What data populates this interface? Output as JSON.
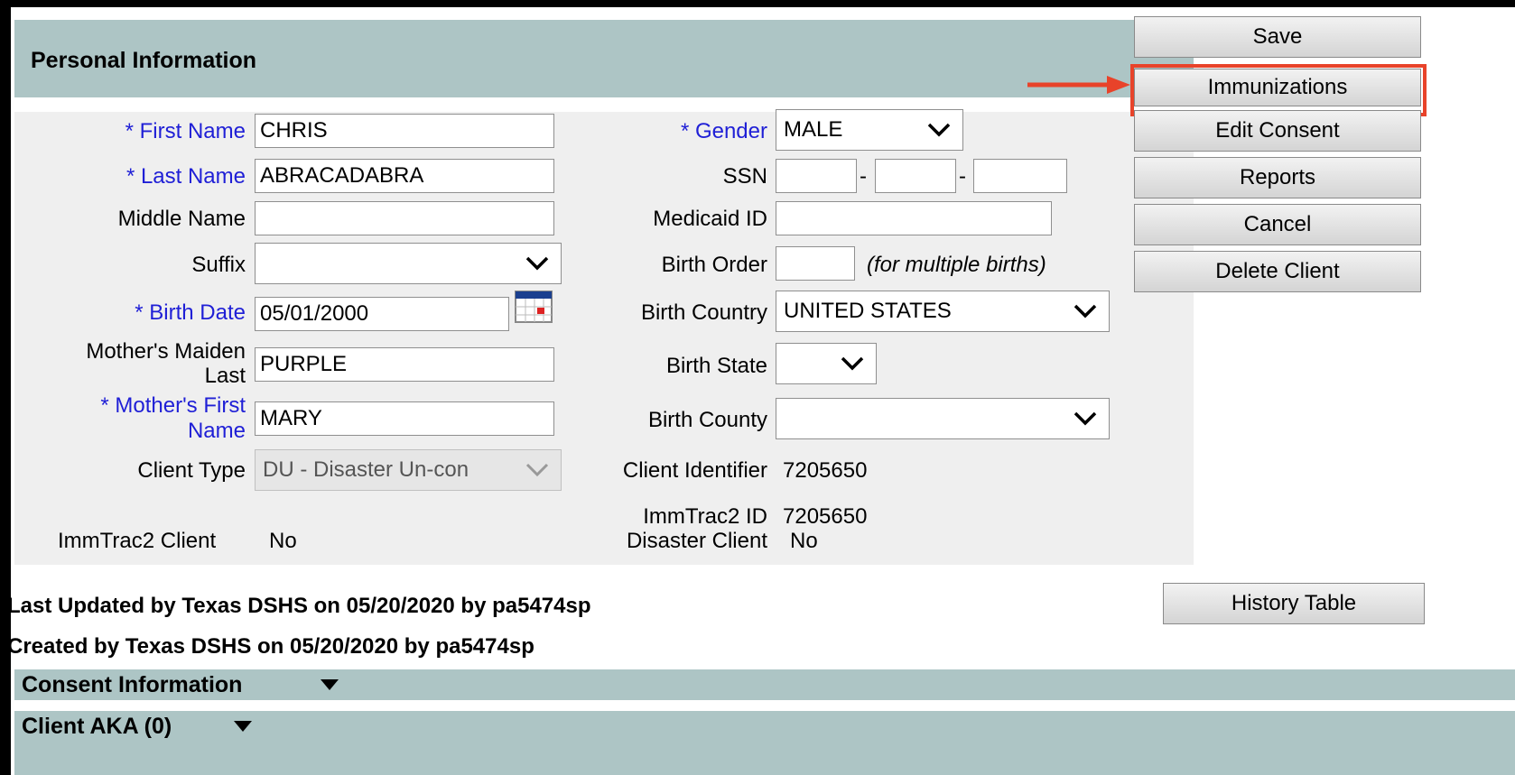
{
  "header": {
    "title": "Personal Information"
  },
  "form": {
    "first_name": {
      "label": "* First Name",
      "value": "CHRIS"
    },
    "last_name": {
      "label": "* Last Name",
      "value": "ABRACADABRA"
    },
    "middle_name": {
      "label": "Middle Name",
      "value": ""
    },
    "suffix": {
      "label": "Suffix",
      "value": ""
    },
    "birth_date": {
      "label": "* Birth Date",
      "value": "05/01/2000"
    },
    "mothers_maiden_last": {
      "label_line1": "Mother's Maiden",
      "label_line2": "Last",
      "value": "PURPLE"
    },
    "mothers_first_name": {
      "label_line1": "* Mother's First",
      "label_line2": "Name",
      "value": "MARY"
    },
    "client_type": {
      "label": "Client Type",
      "value": "DU - Disaster Un-con"
    },
    "immtrac2_client": {
      "label": "ImmTrac2 Client",
      "value": "No"
    },
    "gender": {
      "label": "* Gender",
      "value": "MALE"
    },
    "ssn": {
      "label": "SSN",
      "part1": "",
      "part2": "",
      "part3": "",
      "sep": "-"
    },
    "medicaid_id": {
      "label": "Medicaid ID",
      "value": ""
    },
    "birth_order": {
      "label": "Birth Order",
      "value": "",
      "hint": "(for multiple births)"
    },
    "birth_country": {
      "label": "Birth Country",
      "value": "UNITED STATES"
    },
    "birth_state": {
      "label": "Birth State",
      "value": ""
    },
    "birth_county": {
      "label": "Birth County",
      "value": ""
    },
    "client_identifier": {
      "label": "Client Identifier",
      "value": "7205650"
    },
    "immtrac2_id": {
      "label": "ImmTrac2 ID",
      "value": "7205650"
    },
    "disaster_client": {
      "label": "Disaster Client",
      "value": "No"
    }
  },
  "actions": {
    "save": "Save",
    "immunizations": "Immunizations",
    "edit_consent": "Edit Consent",
    "reports": "Reports",
    "cancel": "Cancel",
    "delete_client": "Delete Client",
    "history_table": "History Table"
  },
  "meta": {
    "last_updated": "Last Updated by Texas DSHS on 05/20/2020 by pa5474sp",
    "created": "Created by Texas DSHS on 05/20/2020 by pa5474sp"
  },
  "sections": {
    "consent_information": "Consent Information",
    "client_aka": "Client AKA (0)"
  },
  "colors": {
    "header_bg": "#adc5c5",
    "required_label": "#1f1fd6",
    "highlight": "#e8432a"
  },
  "icons": [
    "calendar-icon",
    "chevron-down-icon",
    "triangle-down-icon",
    "arrow-right-icon"
  ]
}
